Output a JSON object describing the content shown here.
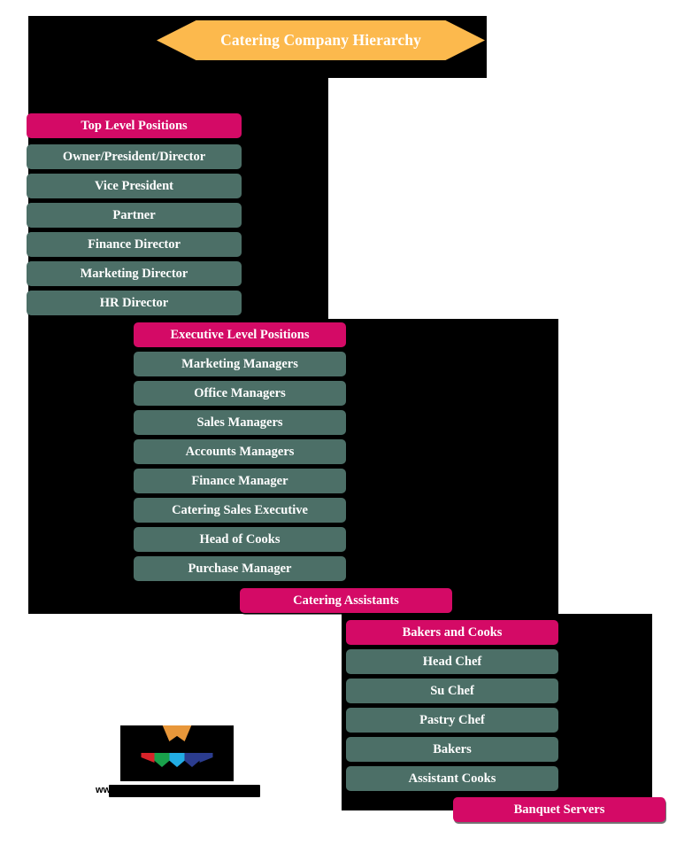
{
  "diagram": {
    "title": "Catering Company Hierarchy",
    "accent_orange": "#FCB94D",
    "accent_pink": "#D40A66",
    "accent_teal": "#4C6F67",
    "backdrop": "#000000"
  },
  "groups": {
    "top_level": {
      "header": "Top Level Positions",
      "items": [
        "Owner/President/Director",
        "Vice President",
        "Partner",
        "Finance Director",
        "Marketing Director",
        "HR Director"
      ]
    },
    "executive_level": {
      "header": "Executive Level Positions",
      "items": [
        "Marketing Managers",
        "Office Managers",
        "Sales Managers",
        "Accounts Managers",
        "Finance Manager",
        "Catering Sales Executive",
        "Head of Cooks",
        "Purchase Manager"
      ]
    },
    "catering_assistants": {
      "header": "Catering Assistants"
    },
    "bakers_and_cooks": {
      "header": "Bakers and Cooks",
      "items": [
        "Head Chef",
        "Su Chef",
        "Pastry Chef",
        "Bakers",
        "Assistant Cooks"
      ]
    },
    "banquet_servers": {
      "header": "Banquet Servers"
    }
  },
  "footer": {
    "url_visible_prefix": "ww"
  }
}
